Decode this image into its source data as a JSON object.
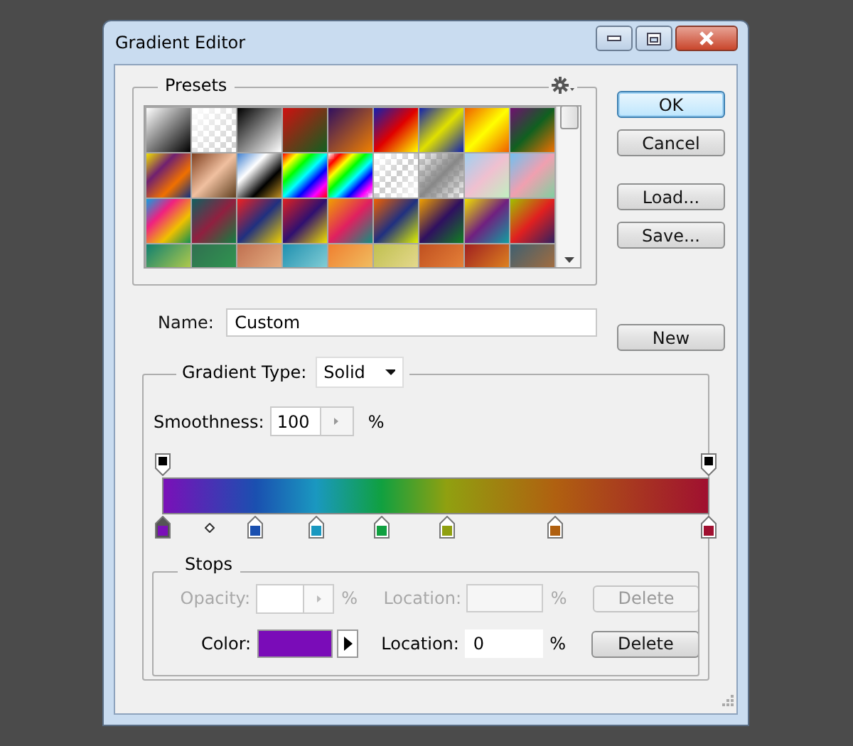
{
  "window": {
    "title": "Gradient Editor"
  },
  "presets": {
    "title": "Presets"
  },
  "buttons": [
    {
      "label": "OK",
      "focused": true
    },
    {
      "label": "Cancel",
      "focused": false
    },
    {
      "label": "Load...",
      "focused": false
    },
    {
      "label": "Save...",
      "focused": false
    }
  ],
  "name": {
    "label": "Name:",
    "value": "Custom",
    "button": "New"
  },
  "gradient_type": {
    "label": "Gradient Type:",
    "value": "Solid"
  },
  "smoothness": {
    "label": "Smoothness:",
    "value": "100",
    "unit": "%"
  },
  "opacity_stops": [
    {
      "level": 0,
      "selected": false
    },
    {
      "level": 1,
      "selected": false
    }
  ],
  "color_stops": [
    {
      "level": 0,
      "color": "#7a10b8",
      "selected": true
    },
    {
      "level": 0.17,
      "color": "#1a50b0",
      "selected": false
    },
    {
      "level": 0.28,
      "color": "#1a98c0",
      "selected": false
    },
    {
      "level": 0.4,
      "color": "#10a040",
      "selected": false
    },
    {
      "level": 0.52,
      "color": "#90a010",
      "selected": false
    },
    {
      "level": 0.72,
      "color": "#b06010",
      "selected": false
    },
    {
      "level": 1,
      "color": "#a01030",
      "selected": false
    }
  ],
  "stops": {
    "title": "Stops",
    "opacity_row": {
      "label": "Opacity:",
      "unit": "%",
      "location_label": "Location:",
      "location_unit": "%",
      "delete": "Delete",
      "disabled": true
    },
    "color_row": {
      "label": "Color:",
      "color": "#7a0cb8",
      "location_label": "Location:",
      "location_value": "0",
      "location_unit": "%",
      "delete": "Delete",
      "disabled": false
    }
  }
}
